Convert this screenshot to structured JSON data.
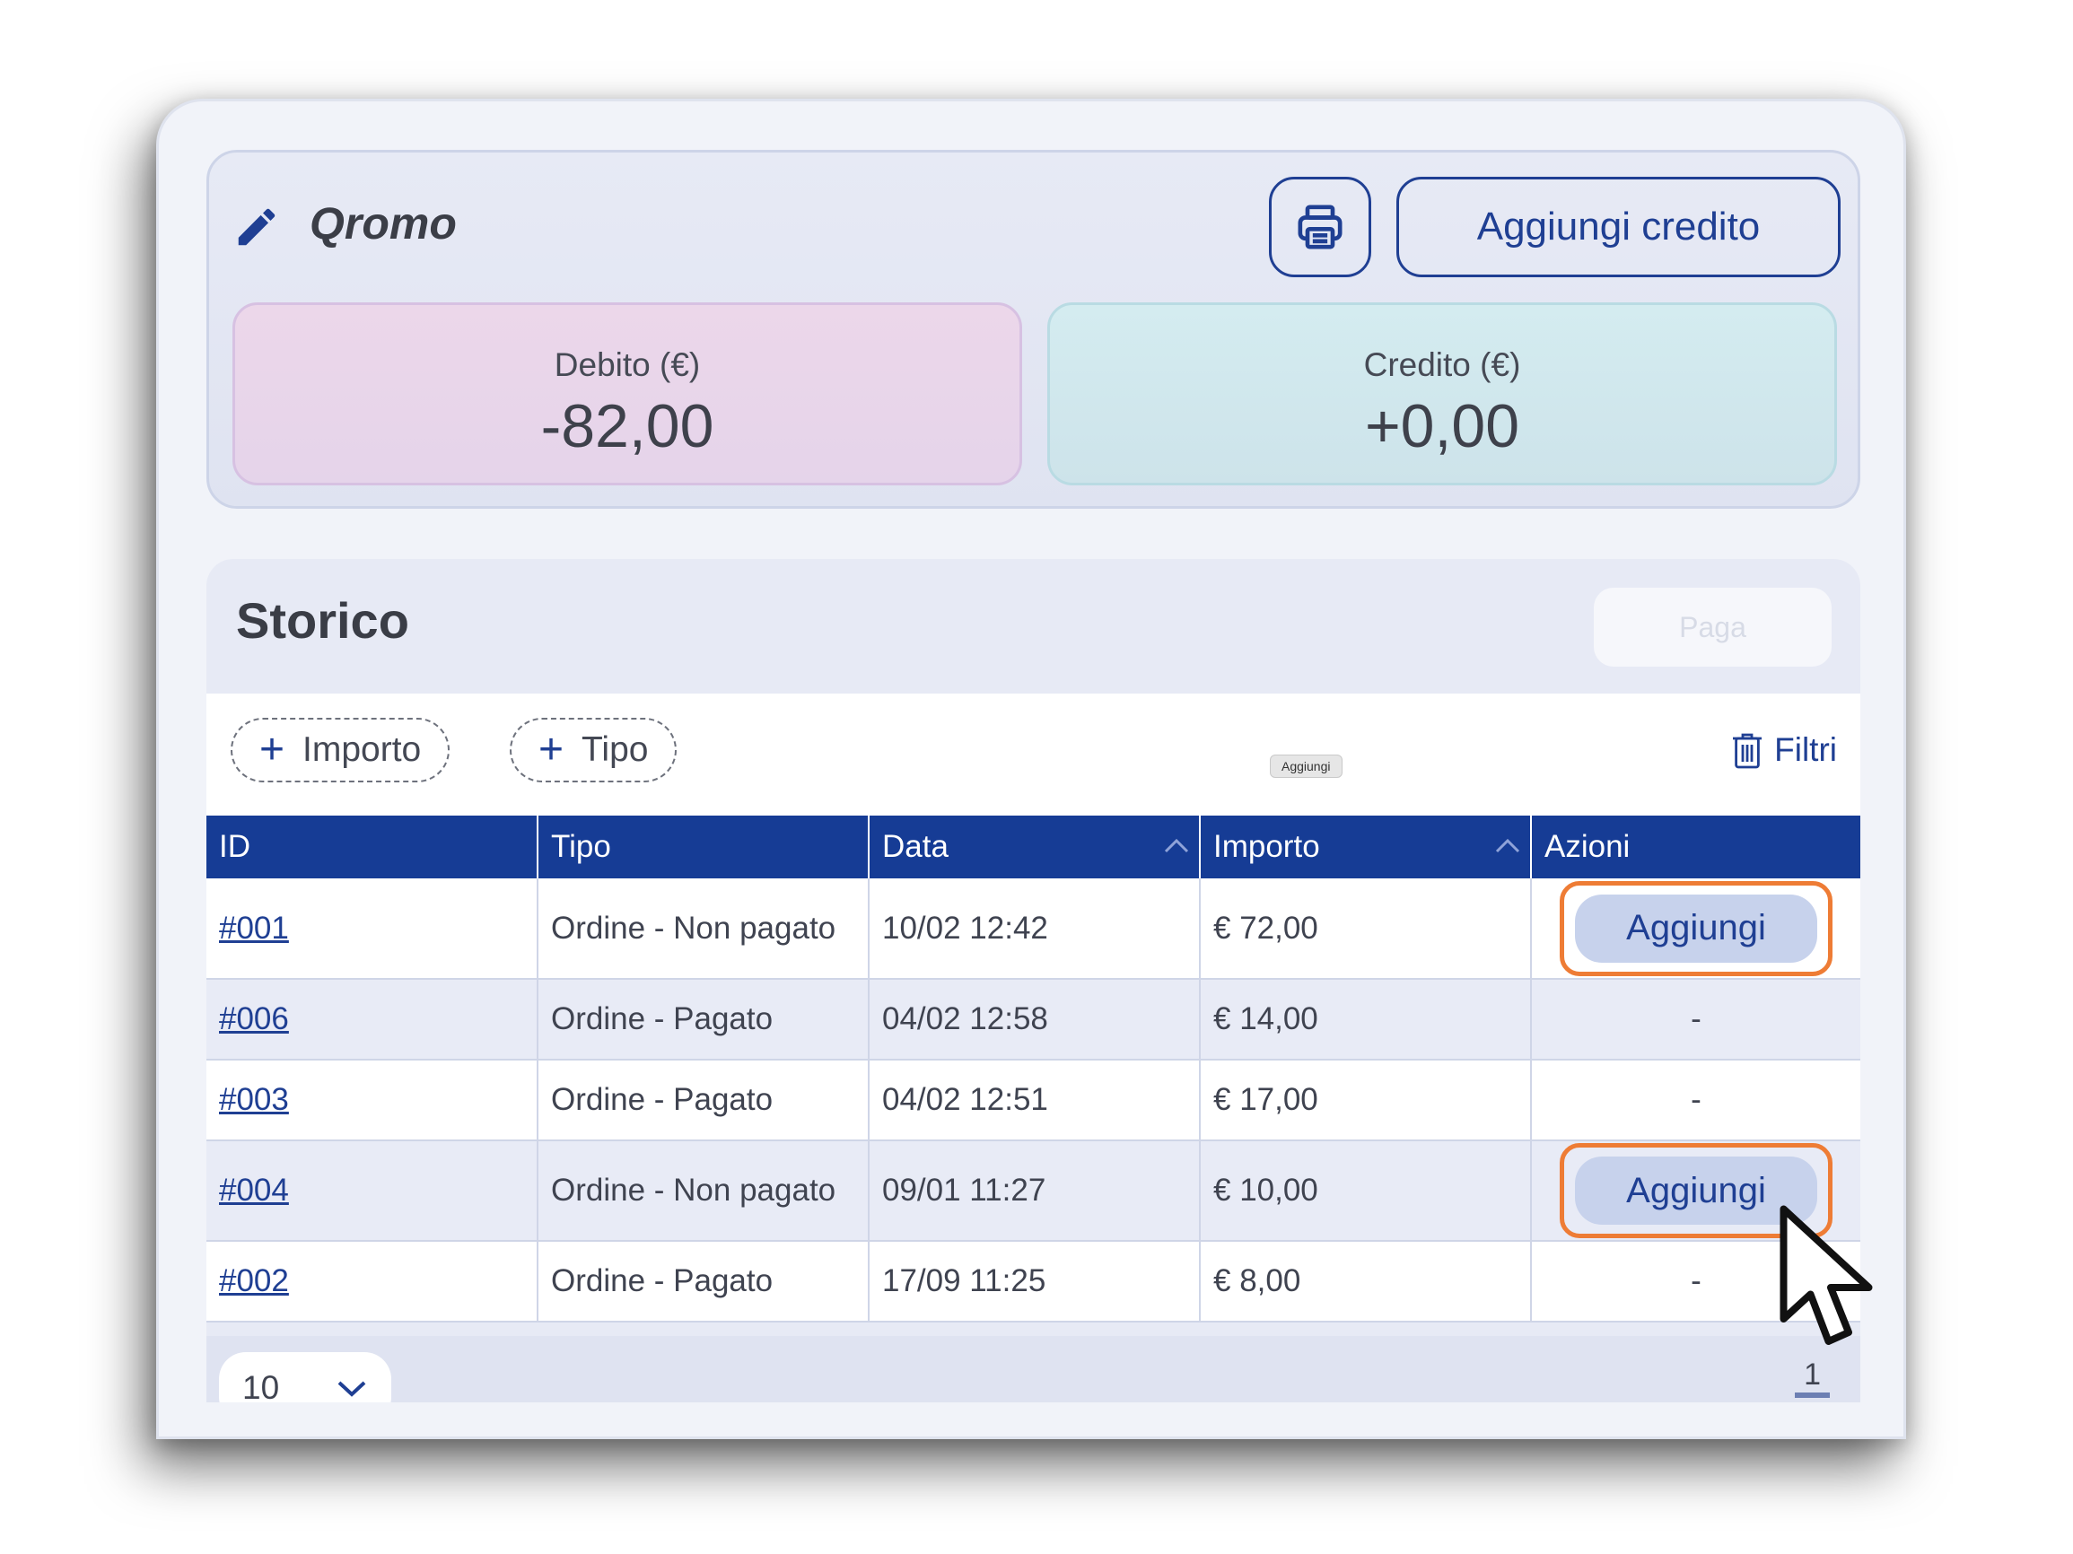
{
  "header": {
    "shop_name": "Qromo",
    "add_credit_label": "Aggiungi credito",
    "print_icon": "printer-icon",
    "edit_icon": "pencil-icon"
  },
  "balance": {
    "debt_label": "Debito (€)",
    "debt_value": "-82,00",
    "credit_label": "Credito (€)",
    "credit_value": "+0,00"
  },
  "history": {
    "title": "Storico",
    "pay_label": "Paga",
    "chips": [
      "Importo",
      "Tipo"
    ],
    "tooltip": "Aggiungi",
    "filters_label": "Filtri",
    "columns": [
      "ID",
      "Tipo",
      "Data",
      "Importo",
      "Azioni"
    ],
    "rows": [
      {
        "id": "#001",
        "type": "Ordine - Non pagato",
        "date": "10/02 12:42",
        "amount": "€ 72,00",
        "action": "Aggiungi"
      },
      {
        "id": "#006",
        "type": "Ordine - Pagato",
        "date": "04/02 12:58",
        "amount": "€ 14,00",
        "action": "-"
      },
      {
        "id": "#003",
        "type": "Ordine - Pagato",
        "date": "04/02 12:51",
        "amount": "€ 17,00",
        "action": "-"
      },
      {
        "id": "#004",
        "type": "Ordine - Non pagato",
        "date": "09/01 11:27",
        "amount": "€ 10,00",
        "action": "Aggiungi"
      },
      {
        "id": "#002",
        "type": "Ordine - Pagato",
        "date": "17/09 11:25",
        "amount": "€ 8,00",
        "action": "-"
      }
    ],
    "page_size": "10",
    "page": "1"
  },
  "colors": {
    "accent": "#163c95",
    "highlight": "#ee7c35"
  }
}
